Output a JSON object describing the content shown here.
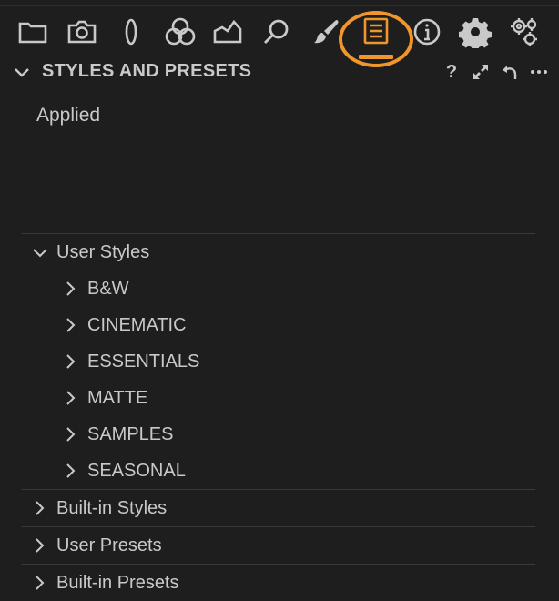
{
  "toolbar": {
    "tools": [
      {
        "icon": "folder-icon"
      },
      {
        "icon": "camera-icon"
      },
      {
        "icon": "lens-icon"
      },
      {
        "icon": "color-circles-icon"
      },
      {
        "icon": "exposure-icon"
      },
      {
        "icon": "magnifier-icon"
      },
      {
        "icon": "brush-icon"
      },
      {
        "icon": "styles-icon",
        "active": true
      },
      {
        "icon": "info-icon"
      },
      {
        "icon": "gear-icon"
      },
      {
        "icon": "gears-icon"
      }
    ],
    "active_color": "#f0962c"
  },
  "panel": {
    "title": "STYLES AND PRESETS",
    "help_label": "?",
    "applied_label": "Applied"
  },
  "tree": {
    "user_styles": "User Styles",
    "children": [
      "B&W",
      "CINEMATIC",
      "ESSENTIALS",
      "MATTE",
      "SAMPLES",
      "SEASONAL"
    ],
    "built_in_styles": "Built-in Styles",
    "user_presets": "User Presets",
    "built_in_presets": "Built-in Presets"
  }
}
